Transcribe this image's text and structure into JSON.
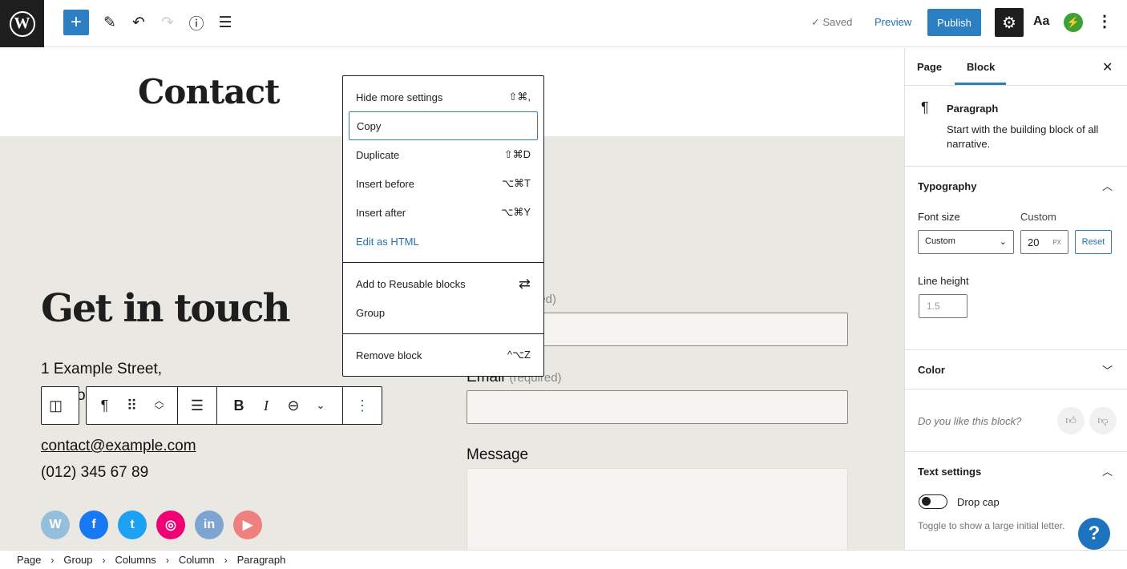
{
  "topbar": {
    "logo": "W",
    "add_icon": "+",
    "saved": "✓ Saved",
    "preview": "Preview",
    "publish": "Publish",
    "styles": "Aa"
  },
  "canvas": {
    "page_title": "Contact",
    "heading": "Get in touch",
    "address_line1": "1 Example Street,",
    "address_line2_partial": "or",
    "email": "contact@example.com",
    "phone": "(012) 345 67 89",
    "social": [
      {
        "name": "wordpress",
        "color": "#93bfdc",
        "glyph": "W"
      },
      {
        "name": "facebook",
        "color": "#1877f2",
        "glyph": "f"
      },
      {
        "name": "twitter",
        "color": "#1da1f2",
        "glyph": "t"
      },
      {
        "name": "instagram",
        "color": "#f00075",
        "glyph": "◎"
      },
      {
        "name": "linkedin",
        "color": "#7ea4d1",
        "glyph": "in"
      },
      {
        "name": "youtube",
        "color": "#f08080",
        "glyph": "▶"
      }
    ],
    "form": {
      "name_label_partial": "ired)",
      "email_label": "Email",
      "email_req": "(required)",
      "message_label": "Message"
    }
  },
  "menu": {
    "items": [
      {
        "label": "Hide more settings",
        "shortcut": "⇧⌘,"
      },
      {
        "label": "Copy",
        "shortcut": ""
      },
      {
        "label": "Duplicate",
        "shortcut": "⇧⌘D"
      },
      {
        "label": "Insert before",
        "shortcut": "⌥⌘T"
      },
      {
        "label": "Insert after",
        "shortcut": "⌥⌘Y"
      },
      {
        "label": "Edit as HTML",
        "shortcut": ""
      },
      {
        "label": "Add to Reusable blocks",
        "shortcut": "⇄"
      },
      {
        "label": "Group",
        "shortcut": ""
      },
      {
        "label": "Remove block",
        "shortcut": "^⌥Z"
      }
    ]
  },
  "sidebar": {
    "tabs": [
      "Page",
      "Block"
    ],
    "active_tab": "Block",
    "block_name": "Paragraph",
    "block_desc": "Start with the building block of all narrative.",
    "typography": {
      "title": "Typography",
      "font_size_label": "Font size",
      "custom_label": "Custom",
      "font_size_select": "Custom",
      "font_size_value": "20",
      "unit": "PX",
      "reset": "Reset",
      "line_height_label": "Line height",
      "line_height_placeholder": "1.5"
    },
    "color": "Color",
    "feedback": "Do you like this block?",
    "text_settings": {
      "title": "Text settings",
      "drop_cap": "Drop cap",
      "drop_cap_on": false,
      "help": "Toggle to show a large initial letter."
    }
  },
  "breadcrumb": [
    "Page",
    "Group",
    "Columns",
    "Column",
    "Paragraph"
  ],
  "help": "?"
}
